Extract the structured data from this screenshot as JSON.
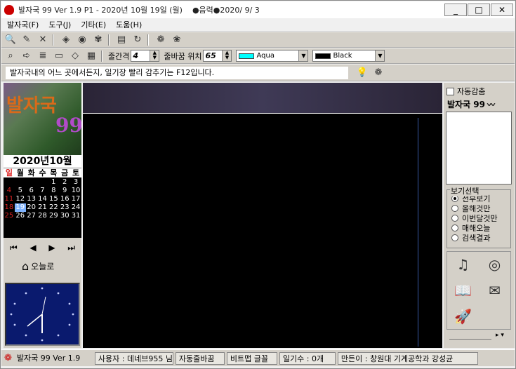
{
  "window": {
    "title": "발자국 99 Ver 1.9 P1 - 2020년 10월 19일 (월)",
    "lunar": "●음력●2020/ 9/ 3",
    "minimize": "_",
    "maximize": "□",
    "close": "✕"
  },
  "menu": [
    "발자국(F)",
    "도구(J)",
    "기타(E)",
    "도움(H)"
  ],
  "toolbar2": {
    "line_spacing_label": "줄간격",
    "line_spacing_value": "4",
    "line_position_label": "줄바꿈 위치",
    "line_position_value": "65",
    "color1_name": "Aqua",
    "color1_hex": "#00ffff",
    "color2_name": "Black",
    "color2_hex": "#000000"
  },
  "tip": "발자국내의 어느 곳에서든지, 일기장 빨리 감추기는 F12입니다.",
  "calendar": {
    "month_title": "2020년10월",
    "weekdays": [
      "일",
      "월",
      "화",
      "수",
      "목",
      "금",
      "토"
    ],
    "days": [
      "",
      "",
      "",
      "",
      "1",
      "2",
      "3",
      "4",
      "5",
      "6",
      "7",
      "8",
      "9",
      "10",
      "11",
      "12",
      "13",
      "14",
      "15",
      "16",
      "17",
      "18",
      "19",
      "20",
      "21",
      "22",
      "23",
      "24",
      "25",
      "26",
      "27",
      "28",
      "29",
      "30",
      "31"
    ],
    "today": "19"
  },
  "left": {
    "logo_text": "발자국",
    "logo_number": "99",
    "today_label": "오늘로"
  },
  "right": {
    "auto_hide_label": "자동감춤",
    "panel_title": "발자국 99",
    "view_group_title": "보기선택",
    "view_options": [
      "전부보기",
      "올해것만",
      "이번달것만",
      "매해오늘",
      "검색결과"
    ],
    "selected_view": 0
  },
  "status": {
    "app": "발자국 99 Ver 1.9",
    "user": "사용자 : 데네브955 님",
    "wrap": "자동줄바꿈",
    "bitmap": "비트맵 글꼴",
    "count": "일기수 : 0개",
    "author": "만든이 : 창원대 기계공학과 강성균"
  }
}
